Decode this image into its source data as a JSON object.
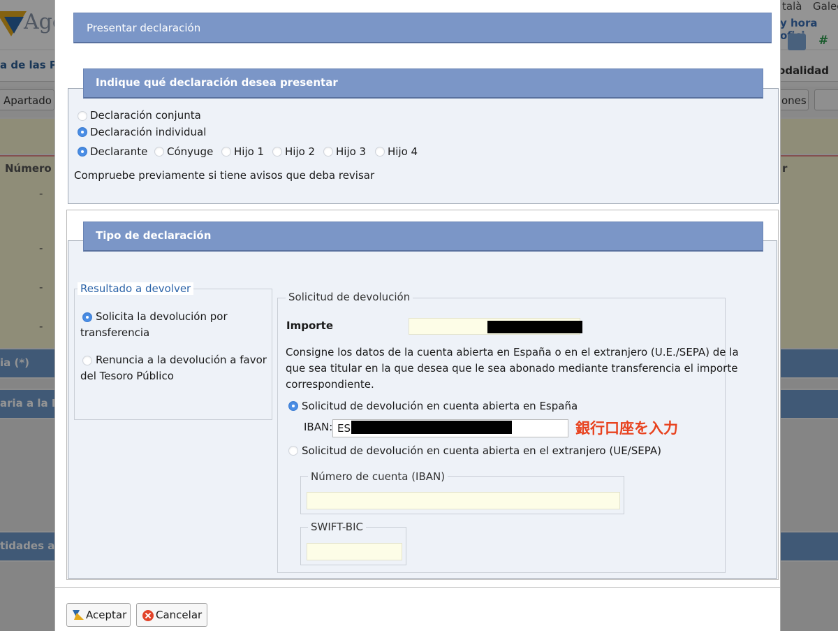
{
  "background_page": {
    "logo_text": "Age",
    "lang_catala": "talà",
    "lang_galego": "Galeg",
    "hora_oficial": "y hora ofici",
    "hash_icon": "#",
    "breadcrumb": "a de las Pe",
    "modalidad": "odalidad",
    "apartado_button": "Apartado",
    "ones_button": "ones",
    "col_numero": "Número I",
    "col_r": "r",
    "dash": "-",
    "band_1": "ia (*)",
    "band_2": "aria a la Igl",
    "band_3": "tidades a a"
  },
  "dialog": {
    "title": "Presentar declaración",
    "section1": {
      "title": "Indique qué declaración desea presentar",
      "option_conjunta": "Declaración conjunta",
      "option_individual": "Declaración individual",
      "selected": "individual",
      "persons": [
        "Declarante",
        "Cónyuge",
        "Hijo 1",
        "Hijo 2",
        "Hijo 3",
        "Hijo 4"
      ],
      "selected_person": "Declarante",
      "notice": "Compruebe previamente si tiene avisos que deba revisar"
    },
    "section2": {
      "title": "Tipo de declaración",
      "resultado": {
        "legend": "Resultado a devolver",
        "option_transfer_line1": "Solicita la devolución por",
        "option_transfer_line2": "transferencia",
        "option_renuncia_line1": "Renuncia a la devolución a favor",
        "option_renuncia_line2": "del Tesoro Público",
        "selected": "transferencia"
      },
      "solicitud": {
        "legend": "Solicitud de devolución",
        "importe_label": "Importe",
        "description_line1": "Consigne los datos de la cuenta abierta en España o en el extranjero (U.E./SEPA) de la",
        "description_line2": "que sea titular en la que desea que le sea abonado mediante transferencia el importe",
        "description_line3": "correspondiente.",
        "option_spain": "Solicitud de devolución en cuenta abierta en España",
        "iban_label": "IBAN:",
        "iban_value": "ES",
        "option_foreign": "Solicitud de devolución en cuenta abierta en el extranjero (UE/SEPA)",
        "numero_cuenta_legend": "Número de cuenta (IBAN)",
        "swift_legend": "SWIFT-BIC",
        "selected": "spain"
      },
      "annotation": "銀行口座を入力"
    },
    "buttons": {
      "accept": "Aceptar",
      "cancel": "Cancelar"
    }
  },
  "colors": {
    "header_blue": "#7b96c7",
    "radio_selected": "#4a8ee6",
    "annotation_red": "#e8421e",
    "input_yellow": "#fdfde7"
  }
}
